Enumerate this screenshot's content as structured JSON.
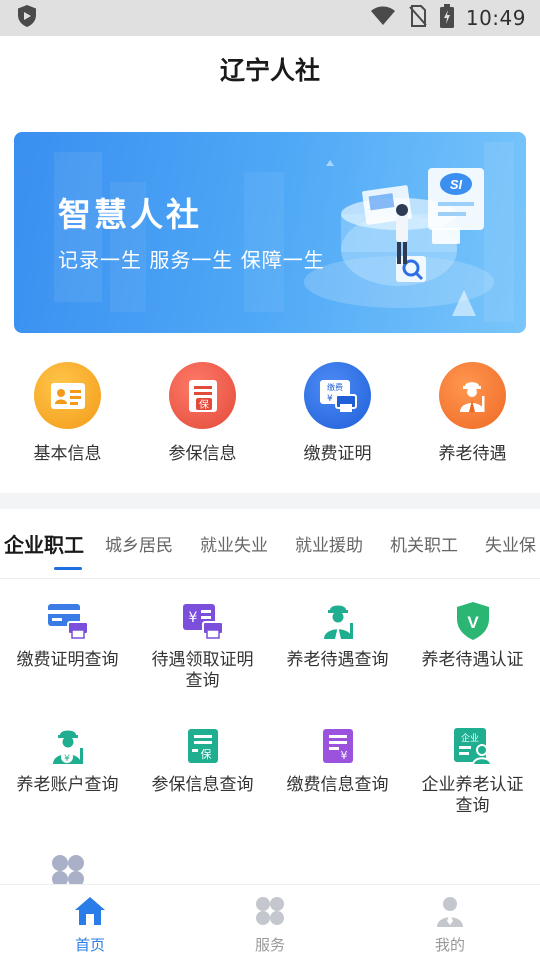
{
  "status_bar": {
    "time": "10:49"
  },
  "app": {
    "title": "辽宁人社"
  },
  "banner": {
    "title": "智慧人社",
    "subtitle": "记录一生  服务一生  保障一生",
    "badge": "SI"
  },
  "quick_actions": [
    {
      "label": "基本信息",
      "icon": "id-card-icon",
      "color": "#f6a623"
    },
    {
      "label": "参保信息",
      "icon": "insurance-doc-icon",
      "color": "#ee5a4a"
    },
    {
      "label": "缴费证明",
      "icon": "payment-printer-icon",
      "color": "#2f6fe6",
      "icon_text": "缴费"
    },
    {
      "label": "养老待遇",
      "icon": "elder-icon",
      "color": "#f4762d"
    }
  ],
  "tabs": [
    {
      "label": "企业职工",
      "active": true
    },
    {
      "label": "城乡居民"
    },
    {
      "label": "就业失业"
    },
    {
      "label": "就业援助"
    },
    {
      "label": "机关职工"
    },
    {
      "label": "失业保"
    }
  ],
  "services": [
    {
      "label": "缴费证明查询",
      "icon": "card-printer-icon"
    },
    {
      "label": "待遇领取证明查询",
      "icon": "yen-printer-icon"
    },
    {
      "label": "养老待遇查询",
      "icon": "elder-icon"
    },
    {
      "label": "养老待遇认证",
      "icon": "shield-v-icon",
      "icon_text": "V"
    },
    {
      "label": "养老账户查询",
      "icon": "elder-yen-icon"
    },
    {
      "label": "参保信息查询",
      "icon": "insurance-doc-icon",
      "icon_text": "保"
    },
    {
      "label": "缴费信息查询",
      "icon": "yen-doc-icon"
    },
    {
      "label": "企业养老认证查询",
      "icon": "enterprise-auth-icon",
      "icon_text": "企业"
    },
    {
      "label": "",
      "icon": "more-services-icon"
    }
  ],
  "bottom_nav": [
    {
      "label": "首页",
      "icon": "home-icon",
      "active": true
    },
    {
      "label": "服务",
      "icon": "clover-icon"
    },
    {
      "label": "我的",
      "icon": "user-icon"
    }
  ],
  "colors": {
    "accent_blue": "#2a7de8",
    "icon_purple": "#7b4fdc",
    "icon_teal": "#1fae8f",
    "icon_green": "#2bb673",
    "icon_blue": "#3a7be6"
  }
}
